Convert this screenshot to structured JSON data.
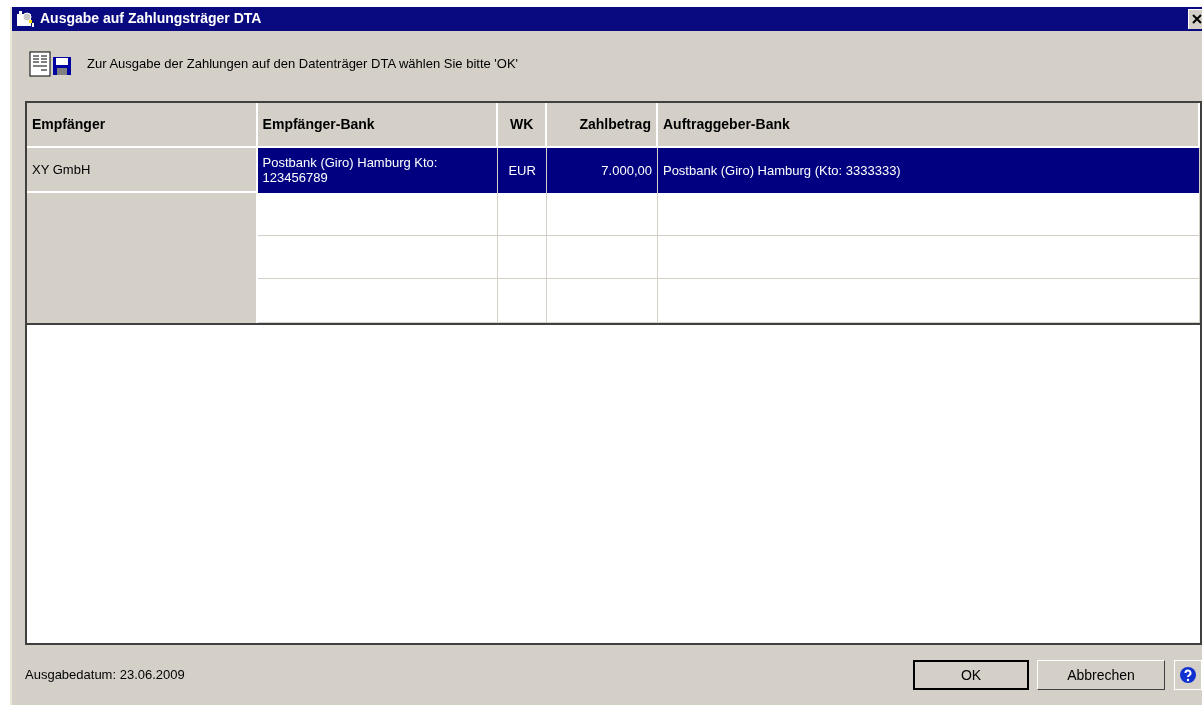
{
  "window": {
    "title": "Ausgabe auf Zahlungsträger DTA"
  },
  "info": "Zur Ausgabe der Zahlungen auf den Datenträger DTA wählen Sie bitte 'OK'",
  "table": {
    "columns": [
      "Empfänger",
      "Empfänger-Bank",
      "WK",
      "Zahlbetrag",
      "Auftraggeber-Bank"
    ],
    "rows": [
      {
        "selected": true,
        "cells": [
          "XY GmbH",
          "Postbank (Giro) Hamburg  Kto: 123456789",
          "EUR",
          "7.000,00",
          "Postbank (Giro) Hamburg (Kto: 3333333)"
        ]
      }
    ]
  },
  "status": "Ausgabedatum: 23.06.2009",
  "buttons": [
    "OK",
    "Abbrechen"
  ]
}
